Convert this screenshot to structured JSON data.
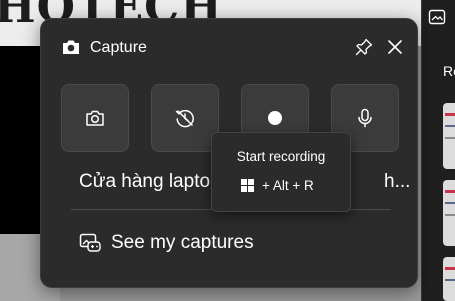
{
  "background": {
    "brand_text": "HOTECH"
  },
  "widget": {
    "title": "Capture",
    "title_icon": "camera-icon",
    "pin_icon": "pin-icon",
    "close_icon": "close-icon",
    "buttons": [
      {
        "name": "take-screenshot",
        "icon": "camera-icon"
      },
      {
        "name": "record-last-30s",
        "icon": "history-icon"
      },
      {
        "name": "start-recording",
        "icon": "record-dot-icon"
      },
      {
        "name": "microphone-toggle",
        "icon": "microphone-icon"
      }
    ],
    "app_name_left": "Cửa hàng lapto",
    "app_name_right": "h...",
    "see_captures_label": "See my captures",
    "see_captures_icon": "gallery-icon"
  },
  "tooltip": {
    "title": "Start recording",
    "shortcut": "+ Alt + R",
    "shortcut_icon": "windows-key-icon"
  },
  "side_panel": {
    "heading": "Re"
  },
  "colors": {
    "widget_bg": "#2b2b2b",
    "button_bg": "#3b3b3b",
    "text": "#ffffff",
    "accent_thumb": "#c8344a"
  }
}
